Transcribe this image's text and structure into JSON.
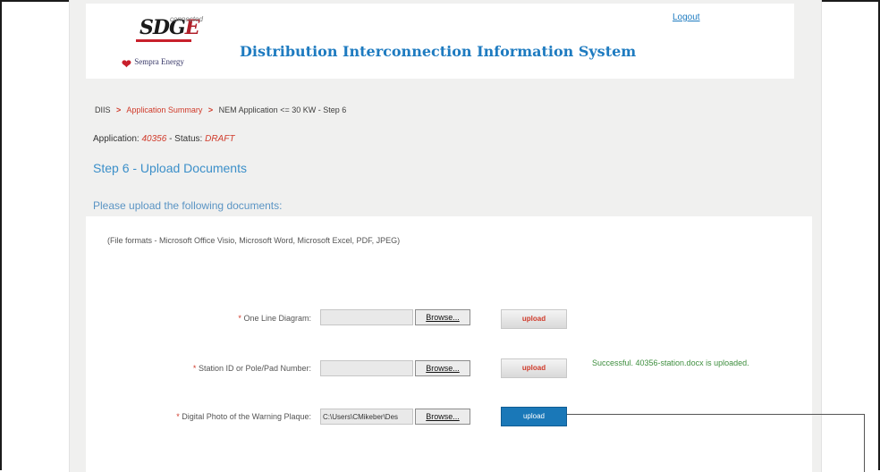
{
  "header": {
    "logo_text": "SDGE",
    "logo_tag": "connected",
    "parent_company": "Sempra Energy",
    "system_title": "Distribution Interconnection Information System",
    "logout": "Logout"
  },
  "breadcrumb": {
    "root": "DIIS",
    "summary": "Application Summary",
    "current": "NEM Application <= 30 KW - Step 6",
    "separator": ">"
  },
  "application": {
    "label": "Application:",
    "number": "40356",
    "status_label": "- Status:",
    "status": "DRAFT"
  },
  "step_title": "Step 6 - Upload Documents",
  "instructions": "Please upload the following documents:",
  "formats": "(File formats - Microsoft Office Visio, Microsoft Word, Microsoft Excel, PDF, JPEG)",
  "documents": [
    {
      "required_mark": "*",
      "label": "One Line Diagram:",
      "file_value": "",
      "browse_label": "Browse...",
      "upload_label": "upload",
      "message": ""
    },
    {
      "required_mark": "*",
      "label": "Station ID or Pole/Pad Number:",
      "file_value": "",
      "browse_label": "Browse...",
      "upload_label": "upload",
      "message": "Successful. 40356-station.docx is uploaded."
    },
    {
      "required_mark": "*",
      "label": "Digital Photo of the Warning Plaque:",
      "file_value": "C:\\Users\\CMikeber\\Des",
      "browse_label": "Browse...",
      "upload_label": "upload",
      "message": ""
    }
  ],
  "colors": {
    "accent_blue": "#1e7bc0",
    "link_red": "#d03a2a",
    "success_green": "#3e8e3e",
    "active_upload": "#1a78b8"
  }
}
